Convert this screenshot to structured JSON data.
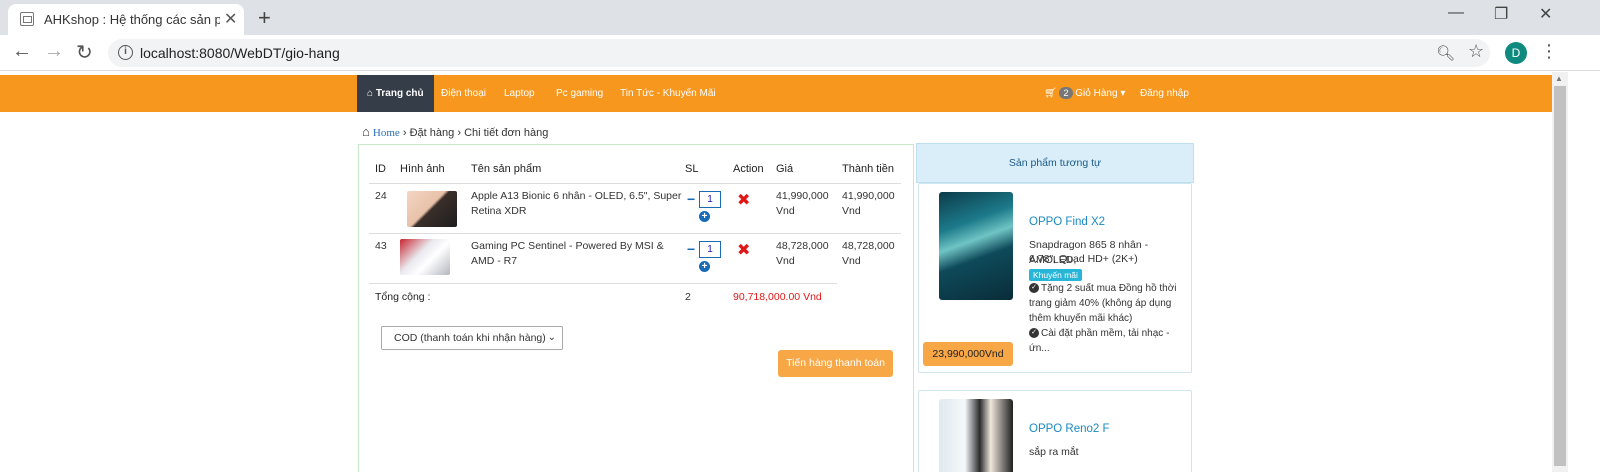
{
  "browser": {
    "tab_title": "AHKshop : Hệ thống các sản phẩ",
    "tab_close": "✕",
    "new_tab": "+",
    "url": "localhost:8080/WebDT/gio-hang",
    "profile_initial": "D",
    "window_minimize": "—",
    "window_restore": "❐",
    "window_close": "✕"
  },
  "navbar": {
    "home": "Trang chủ",
    "phones": "Điện thoại",
    "laptop": "Laptop",
    "pc_gaming": "Pc gaming",
    "news": "Tin Tức - Khuyến Mãi",
    "cart_count": "2",
    "cart_label": "Giỏ Hàng",
    "login": "Đăng nhập",
    "bg_color": "#f7971e",
    "active_color": "#353d48"
  },
  "breadcrumb": {
    "home": "Home",
    "order": "Đặt hàng",
    "detail": "Chi tiết đơn hàng"
  },
  "cart": {
    "headers": {
      "id": "ID",
      "image": "Hình ảnh",
      "name": "Tên sản phẩm",
      "qty": "SL",
      "action": "Action",
      "price": "Giá",
      "subtotal": "Thành tiền"
    },
    "items": [
      {
        "id": "24",
        "name_line1": "Apple A13 Bionic 6 nhân - OLED, 6.5\", Super",
        "name_line2": "Retina XDR",
        "qty": "1",
        "price_line1": "41,990,000",
        "price_line2": "Vnd",
        "subtotal_line1": "41,990,000",
        "subtotal_line2": "Vnd"
      },
      {
        "id": "43",
        "name_line1": "Gaming PC Sentinel - Powered By MSI &",
        "name_line2": "AMD - R7",
        "qty": "1",
        "price_line1": "48,728,000",
        "price_line2": "Vnd",
        "subtotal_line1": "48,728,000",
        "subtotal_line2": "Vnd"
      }
    ],
    "total_label": "Tổng cộng :",
    "total_qty": "2",
    "total_price": "90,718,000.00 Vnd",
    "payment_method": "COD (thanh toán khi nhận hàng)",
    "checkout_button": "Tiến hàng thanh toán"
  },
  "related": {
    "header": "Sản phẩm tương tự",
    "products": [
      {
        "name": "OPPO Find X2",
        "desc_line1": "Snapdragon 865 8 nhân - AMOLED,",
        "desc_line2": "6.78\", Quad HD+ (2K+)",
        "badge": "Khuyến mãi",
        "promo1_line1": "Tặng 2 suất mua Đồng hồ thời",
        "promo1_line2": "trang giảm 40% (không áp dụng",
        "promo1_line3": "thêm khuyến mãi khác)",
        "promo2": "Cài đặt phần mềm, tải nhạc - ứn...",
        "price": "23,990,000Vnd"
      },
      {
        "name": "OPPO Reno2 F",
        "desc_line1": "sắp ra mắt"
      }
    ]
  }
}
